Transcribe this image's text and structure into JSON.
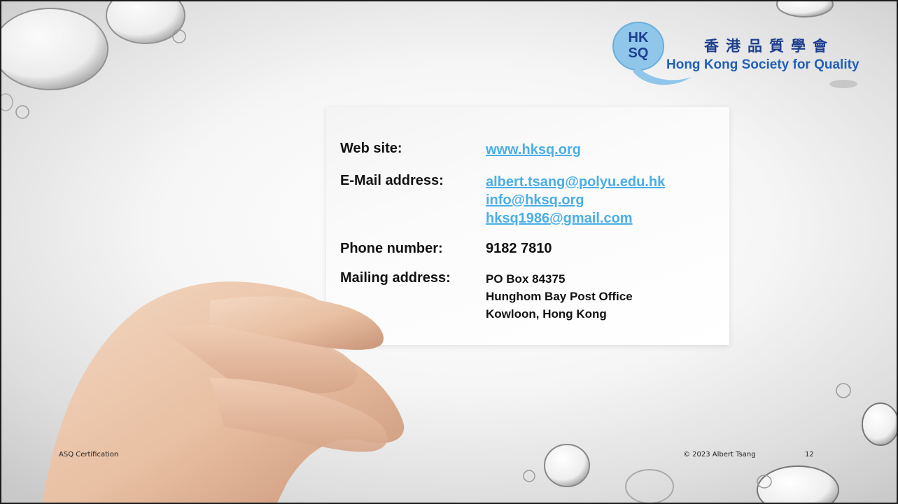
{
  "logo": {
    "badge_line1": "HK",
    "badge_line2": "SQ",
    "name_cn": "香港品質學會",
    "name_en": "Hong Kong Society for Quality"
  },
  "card": {
    "website_label": "Web site:",
    "website_value": "www.hksq.org",
    "email_label": "E-Mail address:",
    "emails": [
      "albert.tsang@polyu.edu.hk",
      "info@hksq.org",
      "hksq1986@gmail.com"
    ],
    "phone_label": "Phone number:",
    "phone_value": "9182 7810",
    "mail_label": "Mailing address:",
    "address_lines": [
      "PO Box 84375",
      "Hunghom Bay Post Office",
      "Kowloon, Hong Kong"
    ]
  },
  "footer": {
    "left": "ASQ Certification",
    "copyright": "© 2023 Albert Tsang",
    "page_number": "12"
  },
  "colors": {
    "link": "#4aaee8",
    "logo_blue": "#1e3f8f",
    "logo_light_blue": "#8fc6ea"
  }
}
